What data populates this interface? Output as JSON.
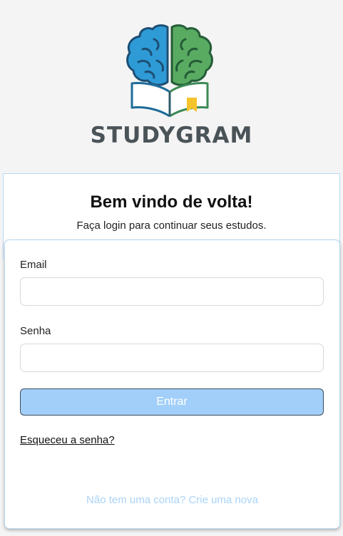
{
  "brand": {
    "name": "STUDYGRAM"
  },
  "welcome": {
    "title": "Bem vindo de volta!",
    "subtitle": "Faça login para continuar seus estudos."
  },
  "form": {
    "email_label": "Email",
    "email_value": "",
    "password_label": "Senha",
    "password_value": "",
    "submit_label": "Entrar",
    "forgot_label": "Esqueceu a senha?",
    "signup_label": "Não tem uma conta? Crie uma nova"
  },
  "colors": {
    "background": "#f4f4f4",
    "brain_left": "#2e9bd6",
    "brain_right": "#5aab62",
    "book_left": "#1e6c9a",
    "book_right": "#3c8a55",
    "bookmark": "#f5c32b",
    "brand_text": "#4a5358",
    "button_fill": "#a2cff9",
    "link_light": "#a9d3f7"
  },
  "icons": {
    "logo": "brain-book-logo"
  }
}
